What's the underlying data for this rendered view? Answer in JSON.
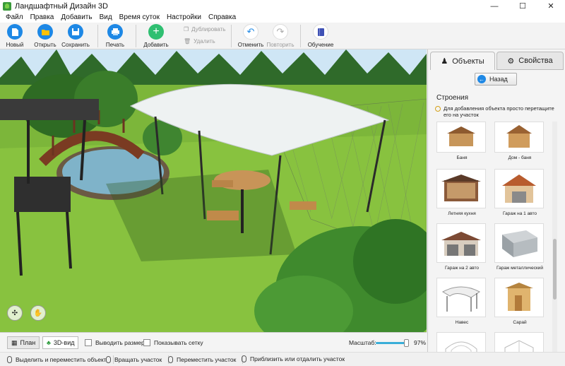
{
  "window": {
    "title": "Ландшафтный Дизайн 3D",
    "minimize": "—",
    "maximize": "☐",
    "close": "✕"
  },
  "menu": [
    "Файл",
    "Правка",
    "Добавить",
    "Вид",
    "Время суток",
    "Настройки",
    "Справка"
  ],
  "toolbar": {
    "new": "Новый",
    "open": "Открыть",
    "save": "Сохранить",
    "print": "Печать",
    "add": "Добавить",
    "duplicate": "Дублировать",
    "delete": "Удалить",
    "undo": "Отменить",
    "redo": "Повторить",
    "learn": "Обучение"
  },
  "sidebar": {
    "tab_objects": "Объекты",
    "tab_properties": "Свойства",
    "back": "Назад",
    "section": "Строения",
    "hint": "Для добавления объекта просто перетащите его на участок",
    "items": [
      {
        "label": "Баня"
      },
      {
        "label": "Дом - баня"
      },
      {
        "label": "Летняя кухня"
      },
      {
        "label": "Гараж на 1 авто"
      },
      {
        "label": "Гараж на 2 авто"
      },
      {
        "label": "Гараж металлический"
      },
      {
        "label": "Навес"
      },
      {
        "label": "Сарай"
      }
    ]
  },
  "viewbar": {
    "plan": "План",
    "view3d": "3D-вид",
    "show_sizes": "Выводить размеры",
    "show_grid": "Показывать сетку",
    "scale_label": "Масштаб:",
    "scale_value": "97%",
    "scale_fraction": 0.97
  },
  "status": {
    "select": "Выделить и переместить объект",
    "rotate": "Вращать участок",
    "move": "Переместить участок",
    "zoom": "Приблизить или отдалить участок"
  },
  "colors": {
    "accent": "#1e88e5",
    "add_green": "#2fbf71",
    "grass": "#79b23a"
  }
}
